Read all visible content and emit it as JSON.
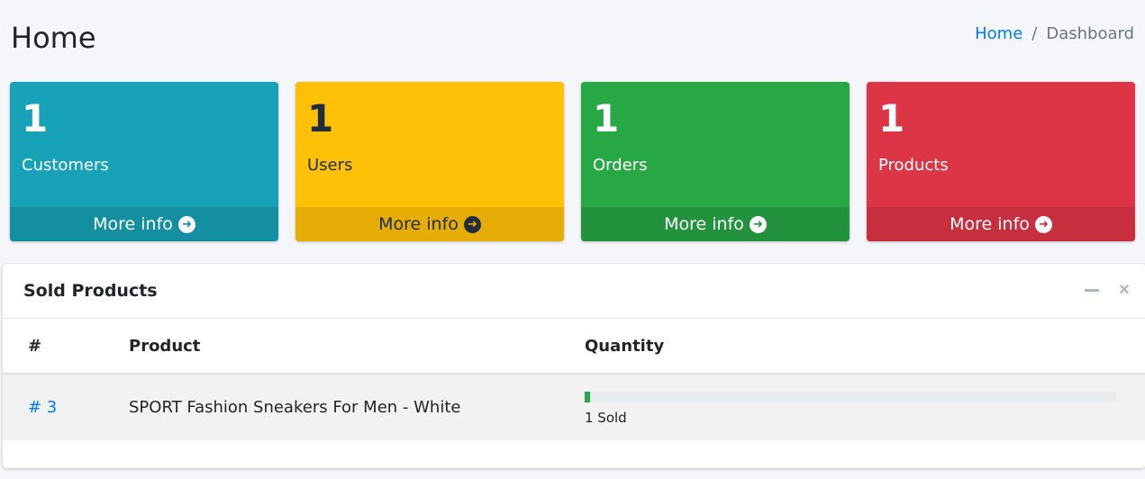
{
  "header": {
    "title": "Home",
    "breadcrumb": {
      "home": "Home",
      "separator": "/",
      "current": "Dashboard"
    }
  },
  "stats": [
    {
      "count": "1",
      "label": "Customers",
      "more": "More info",
      "color": "#17a2b8"
    },
    {
      "count": "1",
      "label": "Users",
      "more": "More info",
      "color": "#ffc107"
    },
    {
      "count": "1",
      "label": "Orders",
      "more": "More info",
      "color": "#28a745"
    },
    {
      "count": "1",
      "label": "Products",
      "more": "More info",
      "color": "#dc3545"
    }
  ],
  "sold_products": {
    "title": "Sold Products",
    "tools": {
      "collapse_icon": "minus-icon",
      "close_icon": "close-icon"
    },
    "columns": [
      "#",
      "Product",
      "Quantity"
    ],
    "rows": [
      {
        "id": "# 3",
        "product": "SPORT Fashion Sneakers For Men - White",
        "sold_fraction": 0.01,
        "sold_label": "1 Sold"
      }
    ]
  },
  "colors": {
    "link": "#007bff",
    "progress": "#28a745",
    "background": "#f4f6f9"
  }
}
